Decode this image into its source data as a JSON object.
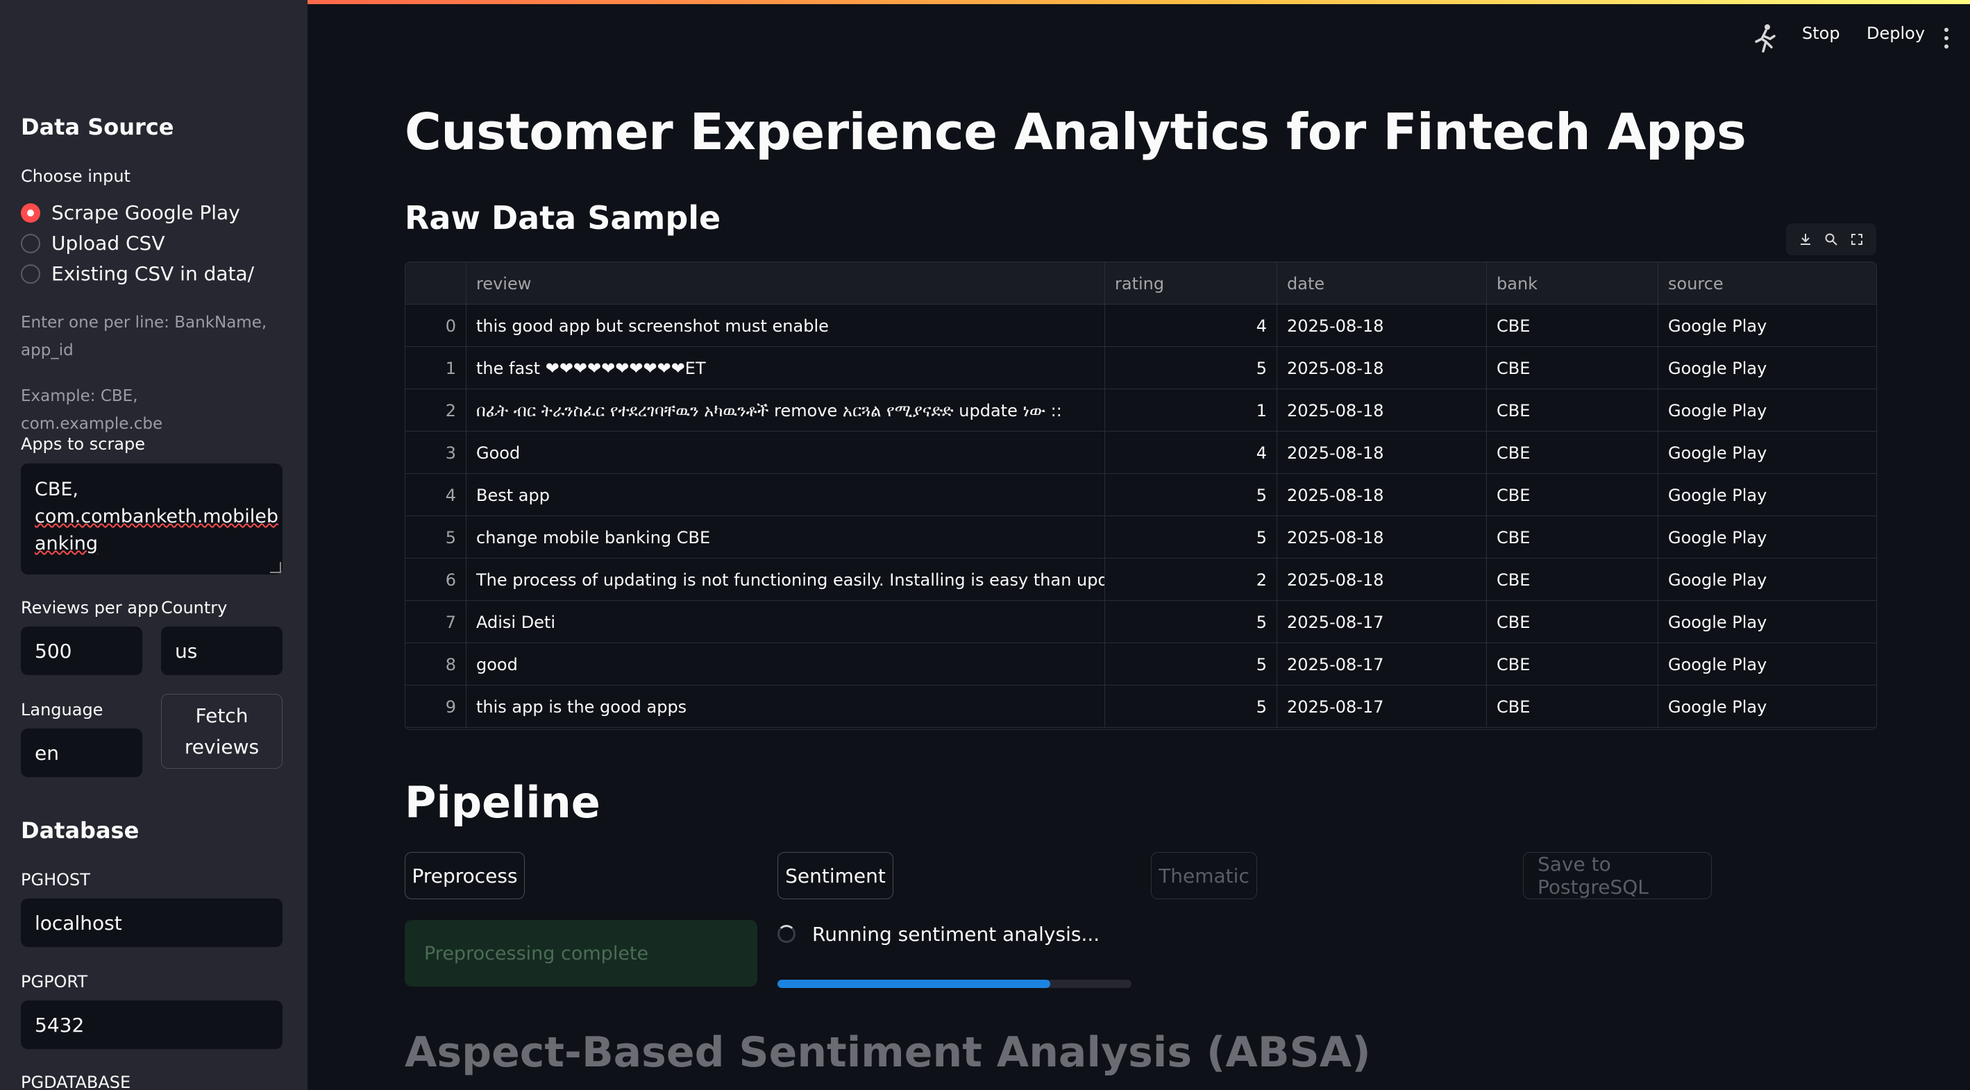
{
  "header": {
    "stop_label": "Stop",
    "deploy_label": "Deploy",
    "running_icon": "running-person-icon",
    "menu_icon": "vertical-ellipsis-icon",
    "accent_gradient": [
      "#ff4b4b",
      "#ffbd45",
      "#fffd80"
    ]
  },
  "sidebar": {
    "data_source_heading": "Data Source",
    "choose_input_label": "Choose input",
    "input_options": [
      "Scrape Google Play",
      "Upload CSV",
      "Existing CSV in data/"
    ],
    "selected_option": "Scrape Google Play",
    "help_line1": "Enter one per line: BankName, app_id",
    "help_example": "Example: CBE, com.example.cbe",
    "apps_label": "Apps to scrape",
    "apps_value_line1": "CBE,",
    "apps_value_line2": "com.combanketh.mobileb",
    "apps_value_line3": "anking",
    "reviews_label": "Reviews per app",
    "reviews_value": "500",
    "country_label": "Country",
    "country_value": "us",
    "language_label": "Language",
    "language_value": "en",
    "fetch_label_line1": "Fetch",
    "fetch_label_line2": "reviews",
    "database_heading": "Database",
    "pghost_label": "PGHOST",
    "pghost_value": "localhost",
    "pgport_label": "PGPORT",
    "pgport_value": "5432",
    "pgdatabase_label": "PGDATABASE"
  },
  "main": {
    "title": "Customer Experience Analytics for Fintech Apps",
    "raw_heading": "Raw Data Sample",
    "table": {
      "columns": [
        "review",
        "rating",
        "date",
        "bank",
        "source"
      ],
      "rows": [
        {
          "idx": "0",
          "review": "this good app but screenshot must enable",
          "rating": "4",
          "date": "2025-08-18",
          "bank": "CBE",
          "source": "Google Play"
        },
        {
          "idx": "1",
          "review": "the fast ❤❤❤❤❤❤❤❤❤❤ET",
          "rating": "5",
          "date": "2025-08-18",
          "bank": "CBE",
          "source": "Google Play"
        },
        {
          "idx": "2",
          "review": "በፊት ብር ትራንስፈር የተደረገባቸዉን አካዉንቶች remove አርጓል የሚያናድድ update ነው ::",
          "rating": "1",
          "date": "2025-08-18",
          "bank": "CBE",
          "source": "Google Play"
        },
        {
          "idx": "3",
          "review": "Good",
          "rating": "4",
          "date": "2025-08-18",
          "bank": "CBE",
          "source": "Google Play"
        },
        {
          "idx": "4",
          "review": "Best app",
          "rating": "5",
          "date": "2025-08-18",
          "bank": "CBE",
          "source": "Google Play"
        },
        {
          "idx": "5",
          "review": "change mobile banking CBE",
          "rating": "5",
          "date": "2025-08-18",
          "bank": "CBE",
          "source": "Google Play"
        },
        {
          "idx": "6",
          "review": "The process of updating is not functioning easily. Installing is easy than updating. Screens",
          "rating": "2",
          "date": "2025-08-18",
          "bank": "CBE",
          "source": "Google Play"
        },
        {
          "idx": "7",
          "review": "Adisi Deti",
          "rating": "5",
          "date": "2025-08-17",
          "bank": "CBE",
          "source": "Google Play"
        },
        {
          "idx": "8",
          "review": "good",
          "rating": "5",
          "date": "2025-08-17",
          "bank": "CBE",
          "source": "Google Play"
        },
        {
          "idx": "9",
          "review": "this app is the good apps",
          "rating": "5",
          "date": "2025-08-17",
          "bank": "CBE",
          "source": "Google Play"
        }
      ]
    },
    "toolbar_icons": [
      "download-icon",
      "search-icon",
      "fullscreen-icon"
    ],
    "pipeline_heading": "Pipeline",
    "pipeline_buttons": {
      "preprocess": "Preprocess",
      "sentiment": "Sentiment",
      "thematic": "Thematic",
      "save": "Save to PostgreSQL"
    },
    "success_message": "Preprocessing complete",
    "running_message": "Running sentiment analysis...",
    "progress_fraction": 0.77,
    "absa_heading": "Aspect-Based Sentiment Analysis (ABSA)",
    "colors": {
      "progress": "#1c83e1",
      "radio_selected": "#ff4b4b"
    }
  }
}
